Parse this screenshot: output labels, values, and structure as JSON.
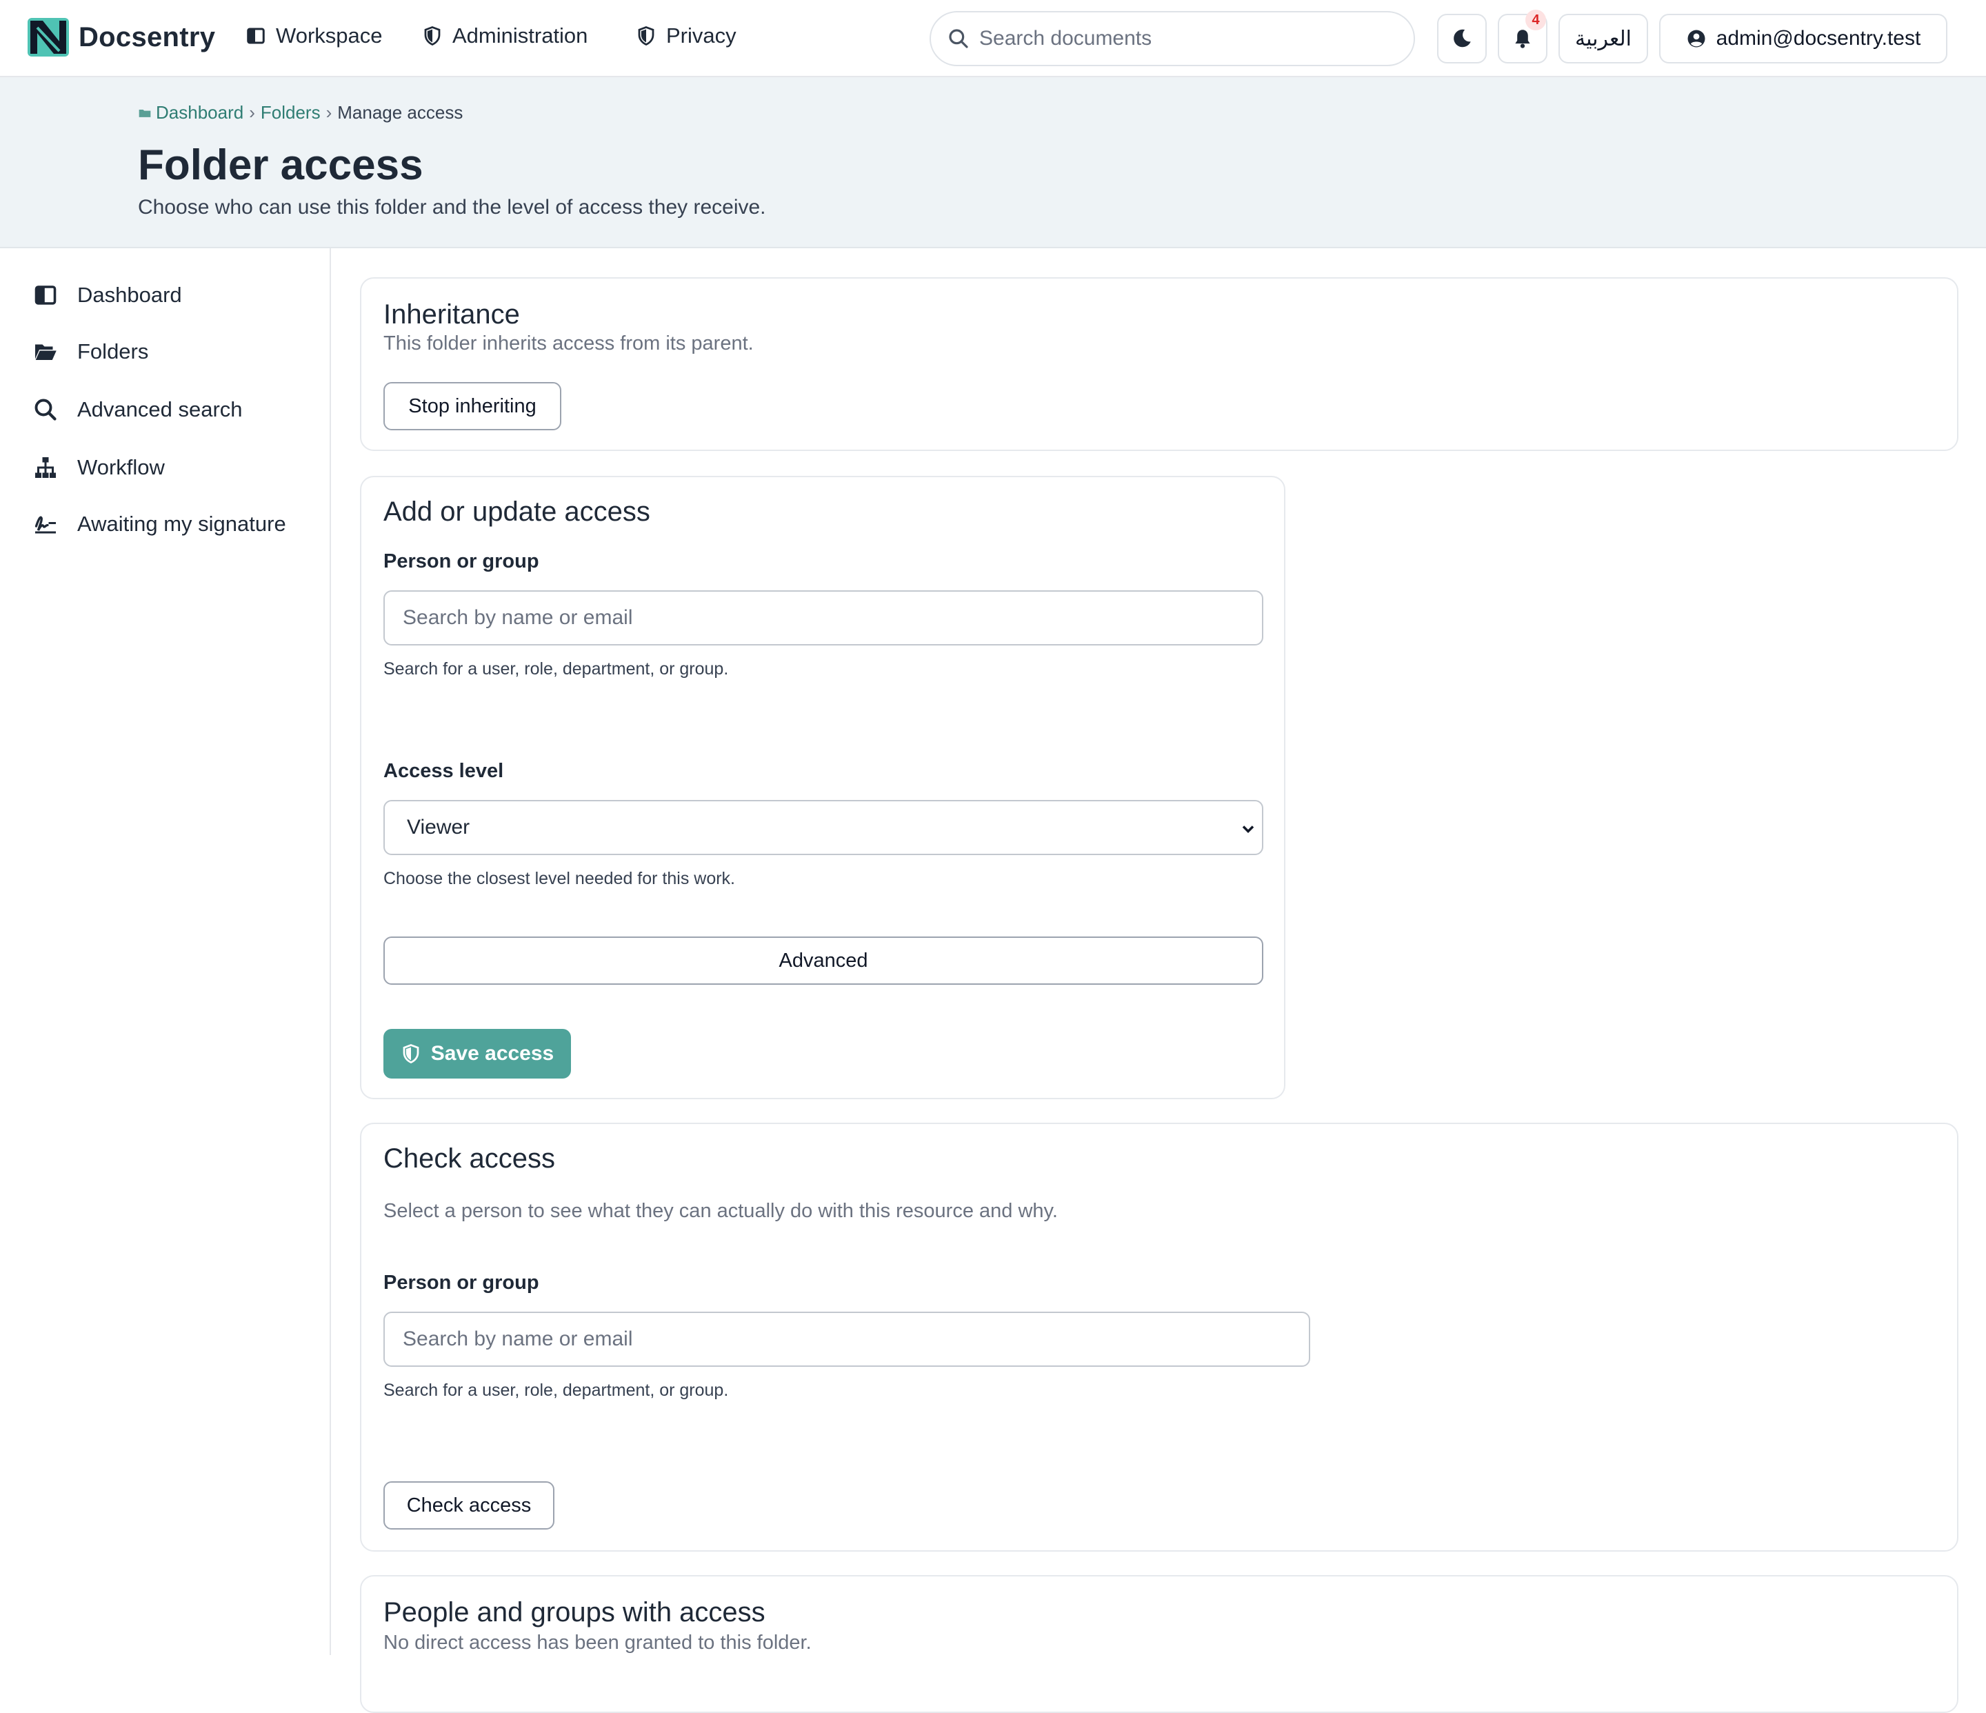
{
  "brand": {
    "name": "Docsentry",
    "logo_icon": "docsentry-logo"
  },
  "topnav": {
    "links": [
      {
        "label": "Workspace",
        "icon": "columns-icon"
      },
      {
        "label": "Administration",
        "icon": "shield-icon"
      },
      {
        "label": "Privacy",
        "icon": "shield-icon"
      }
    ],
    "search_placeholder": "Search documents",
    "notifications_count": "4",
    "language_label": "العربية",
    "user_label": "admin@docsentry.test"
  },
  "breadcrumb": {
    "items": [
      "Dashboard",
      "Folders"
    ],
    "current": "Manage access"
  },
  "header": {
    "title": "Folder access",
    "subtitle": "Choose who can use this folder and the level of access they receive."
  },
  "sidebar": {
    "items": [
      {
        "label": "Dashboard",
        "icon": "columns-icon"
      },
      {
        "label": "Folders",
        "icon": "folder-open-icon"
      },
      {
        "label": "Advanced search",
        "icon": "search-icon"
      },
      {
        "label": "Workflow",
        "icon": "sitemap-icon"
      },
      {
        "label": "Awaiting my signature",
        "icon": "signature-icon"
      }
    ]
  },
  "inheritance": {
    "title": "Inheritance",
    "description": "This folder inherits access from its parent.",
    "button": "Stop inheriting"
  },
  "add_access": {
    "title": "Add or update access",
    "person_label": "Person or group",
    "person_placeholder": "Search by name or email",
    "person_help": "Search for a user, role, department, or group.",
    "level_label": "Access level",
    "level_value": "Viewer",
    "level_help": "Choose the closest level needed for this work.",
    "advanced_button": "Advanced",
    "save_button": "Save access"
  },
  "check_access": {
    "title": "Check access",
    "description": "Select a person to see what they can actually do with this resource and why.",
    "person_label": "Person or group",
    "person_placeholder": "Search by name or email",
    "person_help": "Search for a user, role, department, or group.",
    "button": "Check access"
  },
  "people": {
    "title": "People and groups with access",
    "description": "No direct access has been granted to this folder."
  },
  "colors": {
    "accent": "#4fa39a",
    "link": "#2f7d73",
    "header_band": "#eef3f6",
    "badge": "#dc2626"
  }
}
